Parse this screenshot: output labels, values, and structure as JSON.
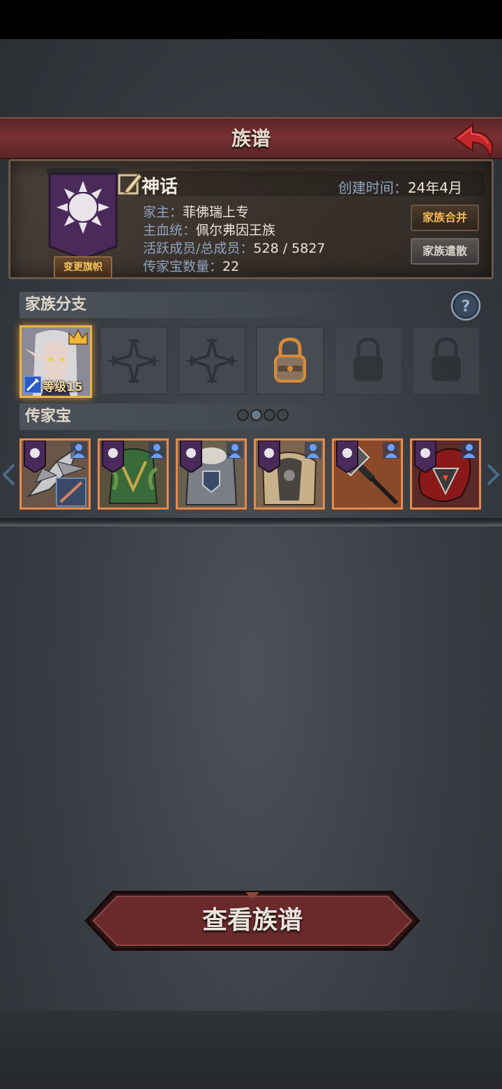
{
  "header": {
    "title": "族谱"
  },
  "clan": {
    "name": "神话",
    "created_label": "创建时间：",
    "created_value": "24年4月",
    "leader_label": "家主：",
    "leader_value": "菲佛瑞上专",
    "bloodline_label": "主血统：",
    "bloodline_value": "佩尔弗因王族",
    "members_label": "活跃成员/总成员：",
    "members_value": "528 / 5827",
    "heirloom_count_label": "传家宝数量：",
    "heirloom_count_value": "22",
    "change_flag_label": "变更旗帜",
    "merge_label": "家族合并",
    "disband_label": "家族遣散"
  },
  "branches": {
    "label": "家族分支",
    "hero_level": "等级15",
    "slots": [
      "hero",
      "cross",
      "cross",
      "lock-active",
      "lock",
      "lock"
    ]
  },
  "heirlooms": {
    "label": "传家宝",
    "page_dots": 4,
    "active_dot": 1,
    "items": [
      "spiked-blade",
      "green-armor",
      "steel-armor",
      "fur-armor",
      "war-hammer",
      "flame-axe"
    ]
  },
  "footer": {
    "view_tree_label": "查看族谱"
  },
  "colors": {
    "accent_gold": "#f4b852",
    "title_red": "#7a3133",
    "item_border": "#e9894a"
  }
}
